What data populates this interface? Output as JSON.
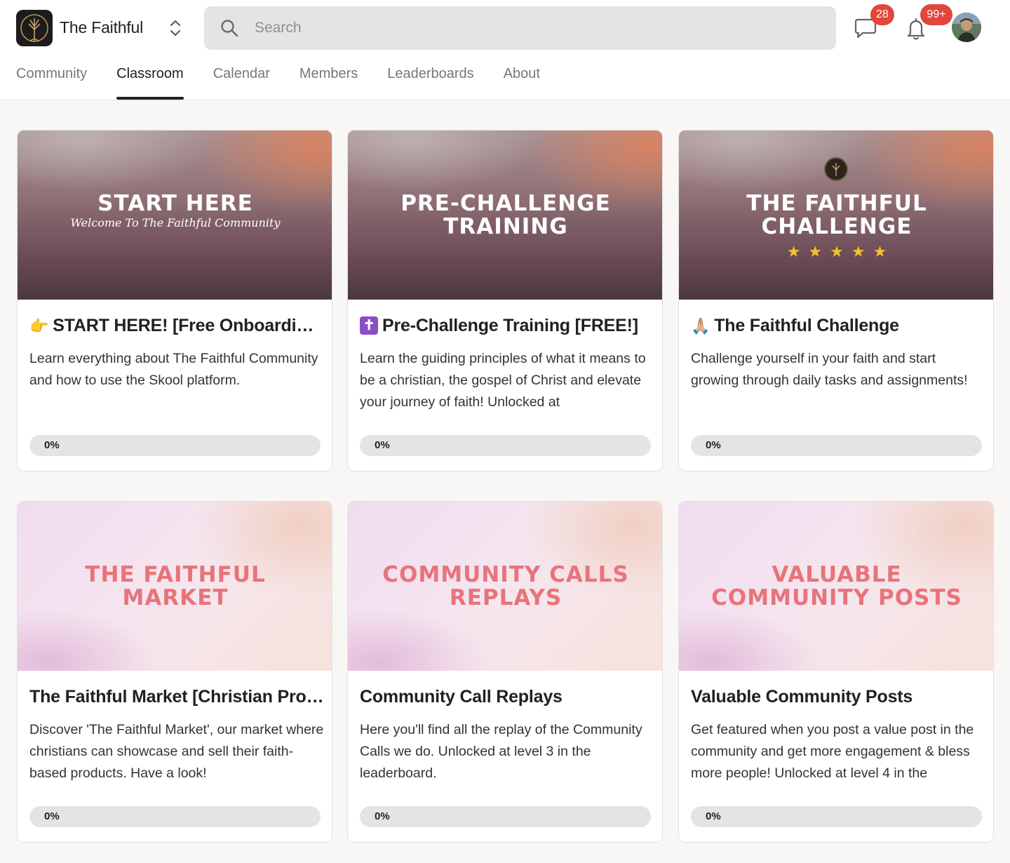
{
  "app": {
    "name": "The Faithful",
    "search_placeholder": "Search",
    "chat_badge": "28",
    "notifications_badge": "99+"
  },
  "nav": {
    "tabs": [
      {
        "label": "Community",
        "active": false
      },
      {
        "label": "Classroom",
        "active": true
      },
      {
        "label": "Calendar",
        "active": false
      },
      {
        "label": "Members",
        "active": false
      },
      {
        "label": "Leaderboards",
        "active": false
      },
      {
        "label": "About",
        "active": false
      }
    ]
  },
  "courses": [
    {
      "cover_title": "START HERE",
      "cover_subtitle": "Welcome To The Faithful Community",
      "emoji": "👉",
      "title": "START HERE! [Free Onboarding!]",
      "description": "Learn everything about The Faithful Community and how to use the Skool platform.",
      "progress_label": "0%",
      "progress_fraction": 0
    },
    {
      "cover_title": "PRE-CHALLENGE\nTRAINING",
      "emoji": "✝",
      "title": "Pre-Challenge Training [FREE!]",
      "description": "Learn the guiding principles of what it means to be a christian, the gospel of Christ and elevate your journey of faith! Unlocked at",
      "progress_label": "0%",
      "progress_fraction": 0
    },
    {
      "cover_title": "THE FAITHFUL\nCHALLENGE",
      "cover_stars": "★★★★★",
      "emoji": "🙏🏼",
      "title": "The Faithful Challenge",
      "description": "Challenge yourself in your faith and start growing through daily tasks and assignments!",
      "progress_label": "0%",
      "progress_fraction": 0
    },
    {
      "cover_title": "THE FAITHFUL\nMARKET",
      "title": "The Faithful Market [Christian Pro…",
      "description": "Discover 'The Faithful Market', our market where christians can showcase and sell their faith-based products. Have a look!",
      "progress_label": "0%",
      "progress_fraction": 0
    },
    {
      "cover_title": "COMMUNITY CALLS\nREPLAYS",
      "title": "Community Call Replays",
      "description": "Here you'll find all the replay of the Community Calls we do. Unlocked at level 3 in the leaderboard.",
      "progress_label": "0%",
      "progress_fraction": 0
    },
    {
      "cover_title": "VALUABLE\nCOMMUNITY POSTS",
      "title": "Valuable Community Posts",
      "description": "Get featured when you post a value post in the community and get more engagement & bless more people! Unlocked at level 4 in the",
      "progress_label": "0%",
      "progress_fraction": 0
    }
  ],
  "colors": {
    "badge": "#e2463a",
    "light_cover_title": "#e8737b",
    "star": "#f2c233"
  }
}
